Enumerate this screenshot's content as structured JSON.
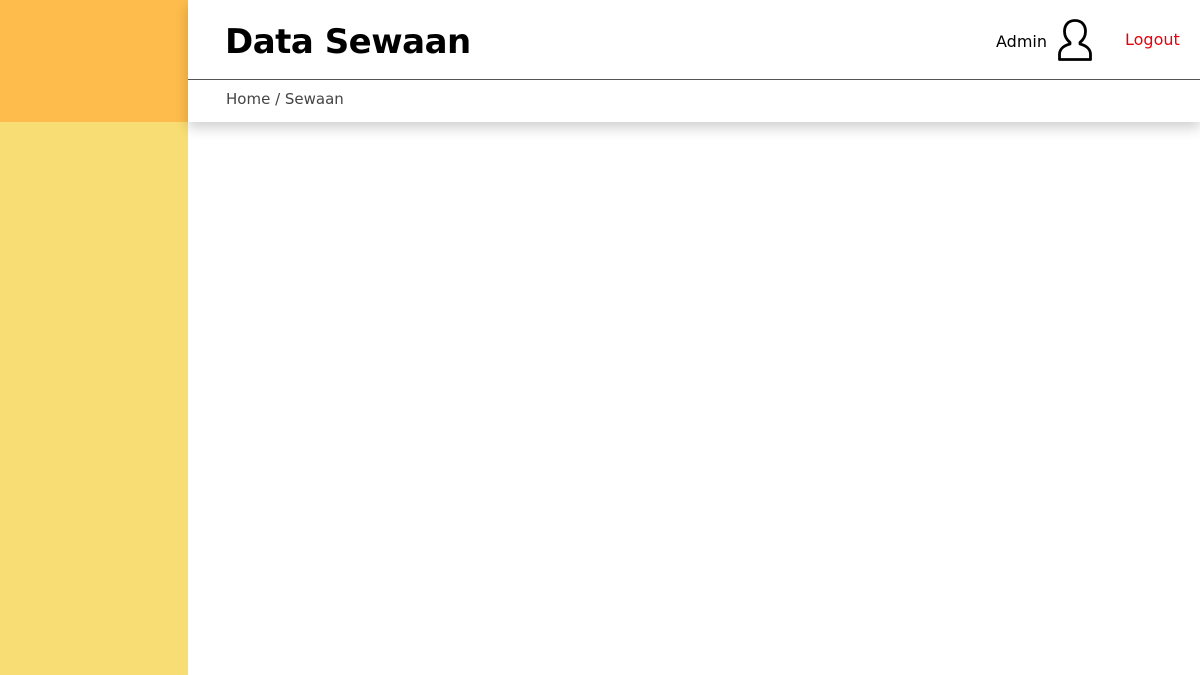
{
  "header": {
    "title": "Data Sewaan",
    "user_name": "Admin",
    "user_icon": "user-icon",
    "logout_label": "Logout"
  },
  "breadcrumb": {
    "home": "Home",
    "separator": " / ",
    "current": "Sewaan"
  },
  "colors": {
    "sidebar": "#f8dc74",
    "sidebar_logo_area": "#fdbc4b",
    "logout": "#e8000b",
    "background": "#ffffff"
  }
}
